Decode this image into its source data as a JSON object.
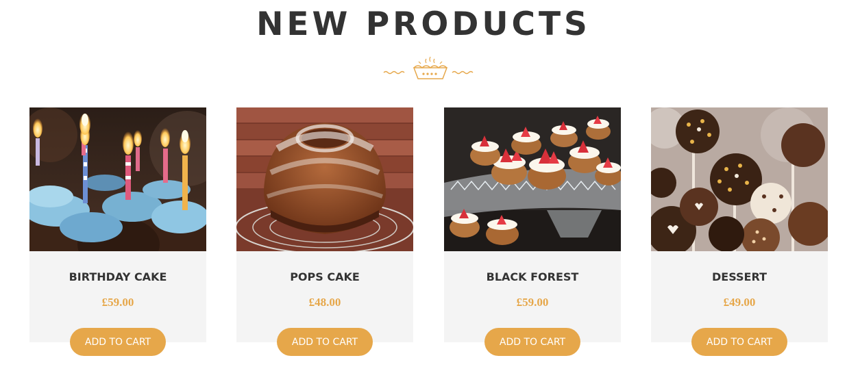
{
  "section": {
    "heading": "NEW PRODUCTS"
  },
  "colors": {
    "accent": "#e6a74a",
    "heading": "#333333",
    "card_bg": "#f4f4f4"
  },
  "icons": {
    "ornament": "pie-ornament-icon"
  },
  "products": [
    {
      "name": "BIRTHDAY CAKE",
      "price": "£59.00",
      "button": "ADD TO CART"
    },
    {
      "name": "POPS CAKE",
      "price": "£48.00",
      "button": "ADD TO CART"
    },
    {
      "name": "BLACK FOREST",
      "price": "£59.00",
      "button": "ADD TO CART"
    },
    {
      "name": "DESSERT",
      "price": "£49.00",
      "button": "ADD TO CART"
    }
  ]
}
